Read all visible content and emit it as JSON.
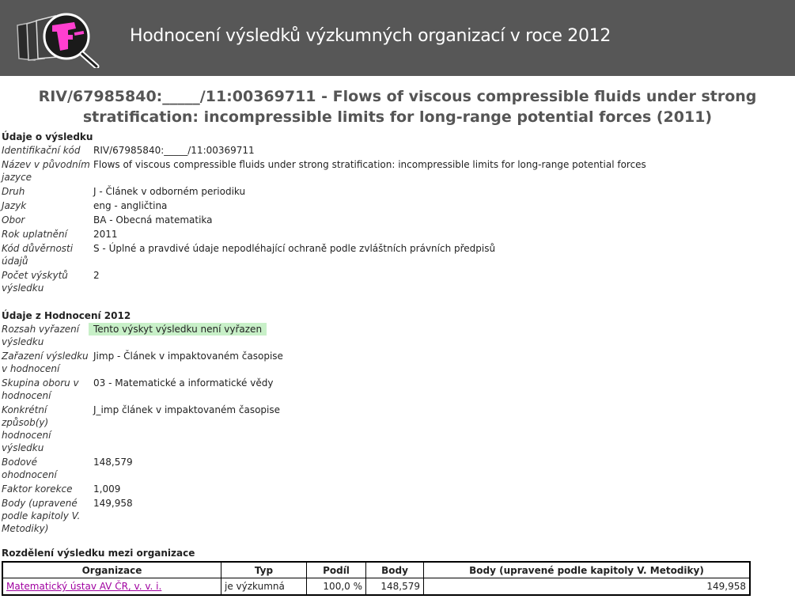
{
  "header": {
    "title": "Hodnocení výsledků výzkumných organizací v roce 2012"
  },
  "page": {
    "title_line1": "RIV/67985840:_____/11:00369711 - Flows of viscous compressible fluids under strong",
    "title_line2": "stratification: incompressible limits for long-range potential forces (2011)"
  },
  "result": {
    "heading": "Údaje o výsledku",
    "rows": [
      {
        "label": "Identifikační kód",
        "value": "RIV/67985840:_____/11:00369711"
      },
      {
        "label": "Název v původním jazyce",
        "value": "Flows of viscous compressible fluids under strong stratification: incompressible limits for long-range potential forces"
      },
      {
        "label": "Druh",
        "value": "J - Článek v odborném periodiku"
      },
      {
        "label": "Jazyk",
        "value": "eng - angličtina"
      },
      {
        "label": "Obor",
        "value": "BA - Obecná matematika"
      },
      {
        "label": "Rok uplatnění",
        "value": "2011"
      },
      {
        "label": "Kód důvěrnosti údajů",
        "value": "S - Úplné a pravdivé údaje nepodléhající ochraně podle zvláštních právních předpisů"
      },
      {
        "label": "Počet výskytů výsledku",
        "value": "2"
      }
    ]
  },
  "evaluation": {
    "heading": "Údaje z Hodnocení 2012",
    "rows": [
      {
        "label": "Rozsah vyřazení výsledku",
        "value": "Tento výskyt výsledku není vyřazen"
      },
      {
        "label": "Zařazení výsledku v hodnocení",
        "value": "Jimp - Článek v impaktovaném časopise"
      },
      {
        "label": "Skupina oboru v hodnocení",
        "value": "03 - Matematické a informatické vědy"
      },
      {
        "label": "Konkrétní způsob(y) hodnocení výsledku",
        "value": "J_imp článek v impaktovaném časopise"
      },
      {
        "label": "Bodové ohodnocení",
        "value": "148,579"
      },
      {
        "label": "Faktor korekce",
        "value": "1,009"
      },
      {
        "label": "Body (upravené podle kapitoly V. Metodiky)",
        "value": "149,958"
      }
    ]
  },
  "distribution": {
    "heading": "Rozdělení výsledku mezi organizace",
    "columns": [
      "Organizace",
      "Typ",
      "Podíl",
      "Body",
      "Body (upravené podle kapitoly V. Metodiky)"
    ],
    "rows": [
      {
        "org": "Matematický ústav AV ČR, v. v. i.",
        "typ": "je výzkumná",
        "podil": "100,0 %",
        "body": "148,579",
        "body_upr": "149,958"
      }
    ]
  },
  "colors": {
    "header_bg": "#575757",
    "highlight": "#c8f0c8",
    "link": "#a000a0"
  }
}
